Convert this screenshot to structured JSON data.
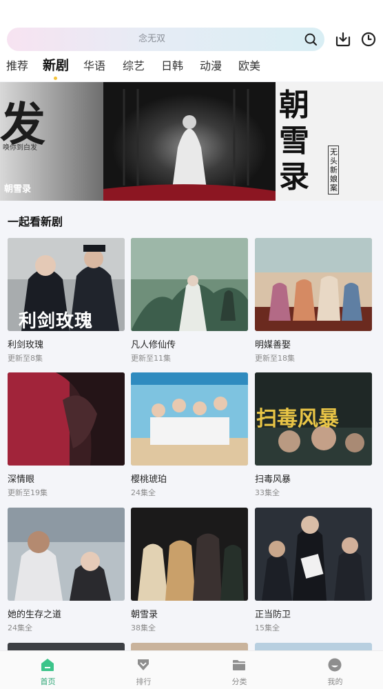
{
  "search": {
    "placeholder": "念无双"
  },
  "header_icons": {
    "download": "download-icon",
    "history": "history-clock-icon"
  },
  "tabs": [
    {
      "label": "推荐",
      "active": false
    },
    {
      "label": "新剧",
      "active": true
    },
    {
      "label": "华语",
      "active": false
    },
    {
      "label": "综艺",
      "active": false
    },
    {
      "label": "日韩",
      "active": false
    },
    {
      "label": "动漫",
      "active": false
    },
    {
      "label": "欧美",
      "active": false
    }
  ],
  "banner": {
    "title": "朝雪录",
    "left_calligraphy": "发",
    "left_caption": "唤你到白发",
    "right_calligraphy": "朝雪录",
    "right_seal": "无头新娘案"
  },
  "section": {
    "title": "一起看新剧"
  },
  "cards": [
    {
      "title": "利剑玫瑰",
      "sub": "更新至8集",
      "poster_text": "利剑玫瑰"
    },
    {
      "title": "凡人修仙传",
      "sub": "更新至11集",
      "poster_text": ""
    },
    {
      "title": "明媒善娶",
      "sub": "更新至18集",
      "poster_text": ""
    },
    {
      "title": "深情眼",
      "sub": "更新至19集",
      "poster_text": ""
    },
    {
      "title": "樱桃琥珀",
      "sub": "24集全",
      "poster_text": ""
    },
    {
      "title": "扫毒风暴",
      "sub": "33集全",
      "poster_text": "扫毒风暴"
    },
    {
      "title": "她的生存之道",
      "sub": "24集全",
      "poster_text": ""
    },
    {
      "title": "朝雪录",
      "sub": "38集全",
      "poster_text": ""
    },
    {
      "title": "正当防卫",
      "sub": "15集全",
      "poster_text": ""
    }
  ],
  "bottom_nav": [
    {
      "label": "首页",
      "icon": "home-icon",
      "active": true
    },
    {
      "label": "排行",
      "icon": "ranking-icon",
      "active": false
    },
    {
      "label": "分类",
      "icon": "category-folder-icon",
      "active": false
    },
    {
      "label": "我的",
      "icon": "profile-icon",
      "active": false
    }
  ],
  "colors": {
    "accent": "#2aa574",
    "tab_dot": "#f3c23a"
  }
}
